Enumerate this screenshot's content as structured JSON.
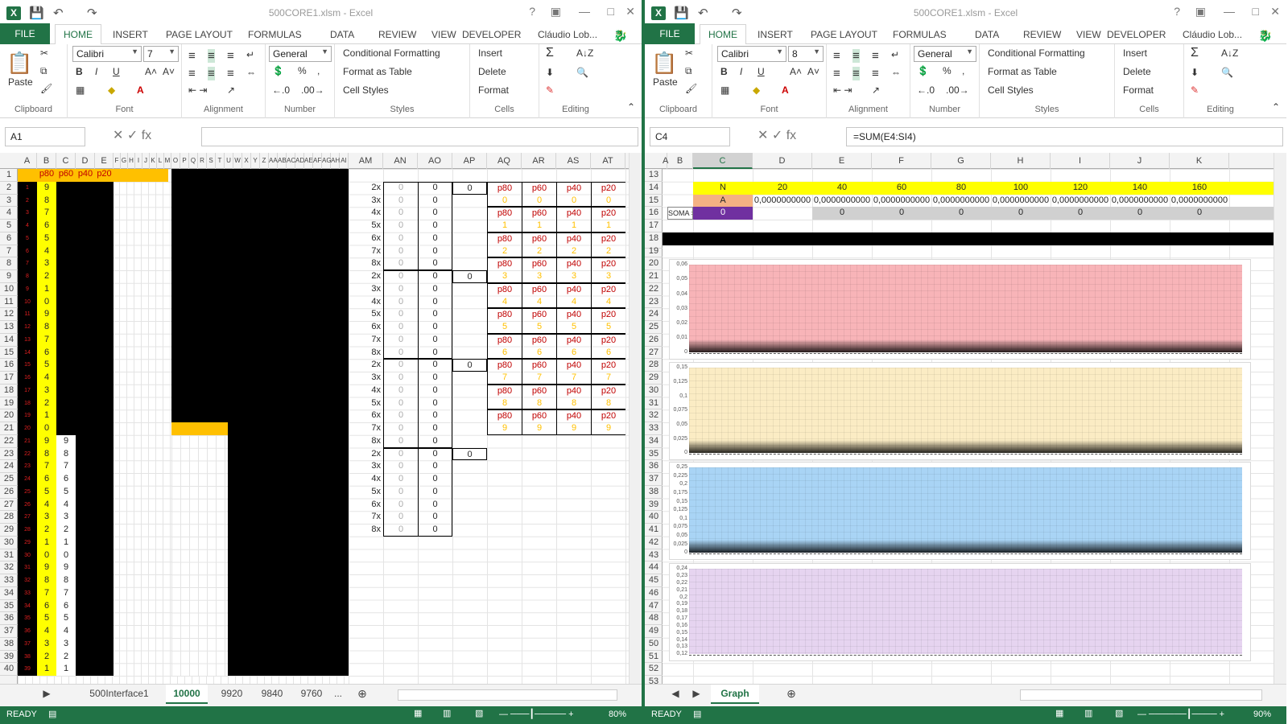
{
  "left": {
    "title": "500CORE1.xlsm - Excel",
    "tabs": [
      "FILE",
      "HOME",
      "INSERT",
      "PAGE LAYOUT",
      "FORMULAS",
      "DATA",
      "REVIEW",
      "VIEW",
      "DEVELOPER"
    ],
    "user": "Cláudio Lob...",
    "font": "Calibri",
    "size": "7",
    "numfmt": "General",
    "ribbon": {
      "paste": "Paste",
      "clipboard": "Clipboard",
      "font": "Font",
      "alignment": "Alignment",
      "number": "Number",
      "styles": "Styles",
      "cells": "Cells",
      "editing": "Editing",
      "cond": "Conditional Formatting",
      "fat": "Format as Table",
      "cs": "Cell Styles",
      "insert": "Insert",
      "delete": "Delete",
      "format": "Format"
    },
    "namebox": "A1",
    "formula": "",
    "cols": [
      "A",
      "B",
      "C",
      "D",
      "E",
      "F",
      "G",
      "H",
      "I",
      "J",
      "K",
      "L",
      "M",
      "O",
      "P",
      "Q",
      "R",
      "S",
      "T",
      "U",
      "W",
      "X",
      "Y",
      "Z",
      "AA",
      "AB",
      "AC",
      "AD",
      "AE",
      "AF",
      "AG",
      "AH",
      "AI",
      "AM",
      "AN",
      "AO",
      "AP",
      "AQ",
      "AR",
      "AS",
      "AT"
    ],
    "header_row": [
      "p80",
      "p60",
      "p40",
      "p20"
    ],
    "a_col": [
      "1",
      "2",
      "3",
      "4",
      "5",
      "6",
      "7",
      "8",
      "9",
      "10",
      "11",
      "12",
      "13",
      "14",
      "15",
      "16",
      "17",
      "18",
      "19",
      "20",
      "21",
      "22",
      "23",
      "24",
      "25",
      "26",
      "27",
      "28",
      "29",
      "30",
      "31",
      "32",
      "33",
      "34",
      "35",
      "36",
      "37",
      "38",
      "39"
    ],
    "b_col": [
      "9",
      "8",
      "7",
      "6",
      "5",
      "4",
      "3",
      "2",
      "1",
      "0",
      "9",
      "8",
      "7",
      "6",
      "5",
      "4",
      "3",
      "2",
      "1",
      "0",
      "9",
      "8",
      "7",
      "6",
      "5",
      "4",
      "3",
      "2",
      "1",
      "0",
      "9",
      "8",
      "7",
      "6",
      "5",
      "4",
      "3",
      "2",
      "1"
    ],
    "c_col": [
      "9",
      "8",
      "7",
      "6",
      "5",
      "4",
      "3",
      "2",
      "1",
      "0",
      "9",
      "8",
      "7",
      "6",
      "5",
      "4",
      "3",
      "2",
      "1"
    ],
    "am_col": [
      "2x",
      "3x",
      "4x",
      "5x",
      "6x",
      "7x",
      "8x",
      "2x",
      "3x",
      "4x",
      "5x",
      "6x",
      "7x",
      "8x",
      "2x",
      "3x",
      "4x",
      "5x",
      "6x",
      "7x",
      "8x",
      "2x",
      "3x",
      "4x",
      "5x",
      "6x",
      "7x",
      "8x"
    ],
    "an_val": "0",
    "ap_val": "0",
    "p_labels": [
      "p80",
      "p60",
      "p40",
      "p20"
    ],
    "p_digits": [
      "0",
      "1",
      "2",
      "3",
      "4",
      "5",
      "6",
      "7",
      "8",
      "9"
    ],
    "sheet_tabs": [
      "500Interface1",
      "10000",
      "9920",
      "9840",
      "9760",
      "..."
    ],
    "status": "READY",
    "zoom": "80%"
  },
  "right": {
    "title": "500CORE1.xlsm - Excel",
    "size": "8",
    "namebox": "C4",
    "formula": "=SUM(E4:SI4)",
    "cols": [
      "A",
      "B",
      "C",
      "D",
      "E",
      "F",
      "G",
      "H",
      "I",
      "J",
      "K"
    ],
    "rows": [
      "13",
      "14",
      "15",
      "16",
      "17",
      "18",
      "19",
      "20",
      "21",
      "22",
      "23",
      "24",
      "25",
      "26",
      "27",
      "28",
      "29",
      "30",
      "31",
      "32",
      "33",
      "34",
      "35",
      "36",
      "37",
      "38",
      "39",
      "40",
      "41",
      "42",
      "43",
      "44",
      "45",
      "46",
      "47",
      "48",
      "49",
      "50",
      "51",
      "52",
      "53"
    ],
    "n_label": "N",
    "n_vals": [
      "20",
      "40",
      "60",
      "80",
      "100",
      "120",
      "140",
      "160"
    ],
    "a_label": "A",
    "a_val": "0,0000000000",
    "soma_label": "SOMA =",
    "soma_val": "0",
    "zero": "0",
    "charts": [
      {
        "color": "#f8b4b8",
        "ticks": [
          "0,06",
          "0,05",
          "0,04",
          "0,03",
          "0,02",
          "0,01",
          "0"
        ]
      },
      {
        "color": "#fbecc4",
        "ticks": [
          "0,15",
          "0,125",
          "0,1",
          "0,075",
          "0,05",
          "0,025",
          "0"
        ]
      },
      {
        "color": "#a9d4f5",
        "ticks": [
          "0,25",
          "0,225",
          "0,2",
          "0,175",
          "0,15",
          "0,125",
          "0,1",
          "0,075",
          "0,05",
          "0,025",
          "0"
        ]
      },
      {
        "color": "#e6d4f0",
        "ticks": [
          "0,24",
          "0,23",
          "0,22",
          "0,21",
          "0,2",
          "0,19",
          "0,18",
          "0,17",
          "0,16",
          "0,15",
          "0,14",
          "0,13",
          "0,12"
        ]
      }
    ],
    "sheet_tab": "Graph",
    "status": "READY",
    "zoom": "90%"
  }
}
